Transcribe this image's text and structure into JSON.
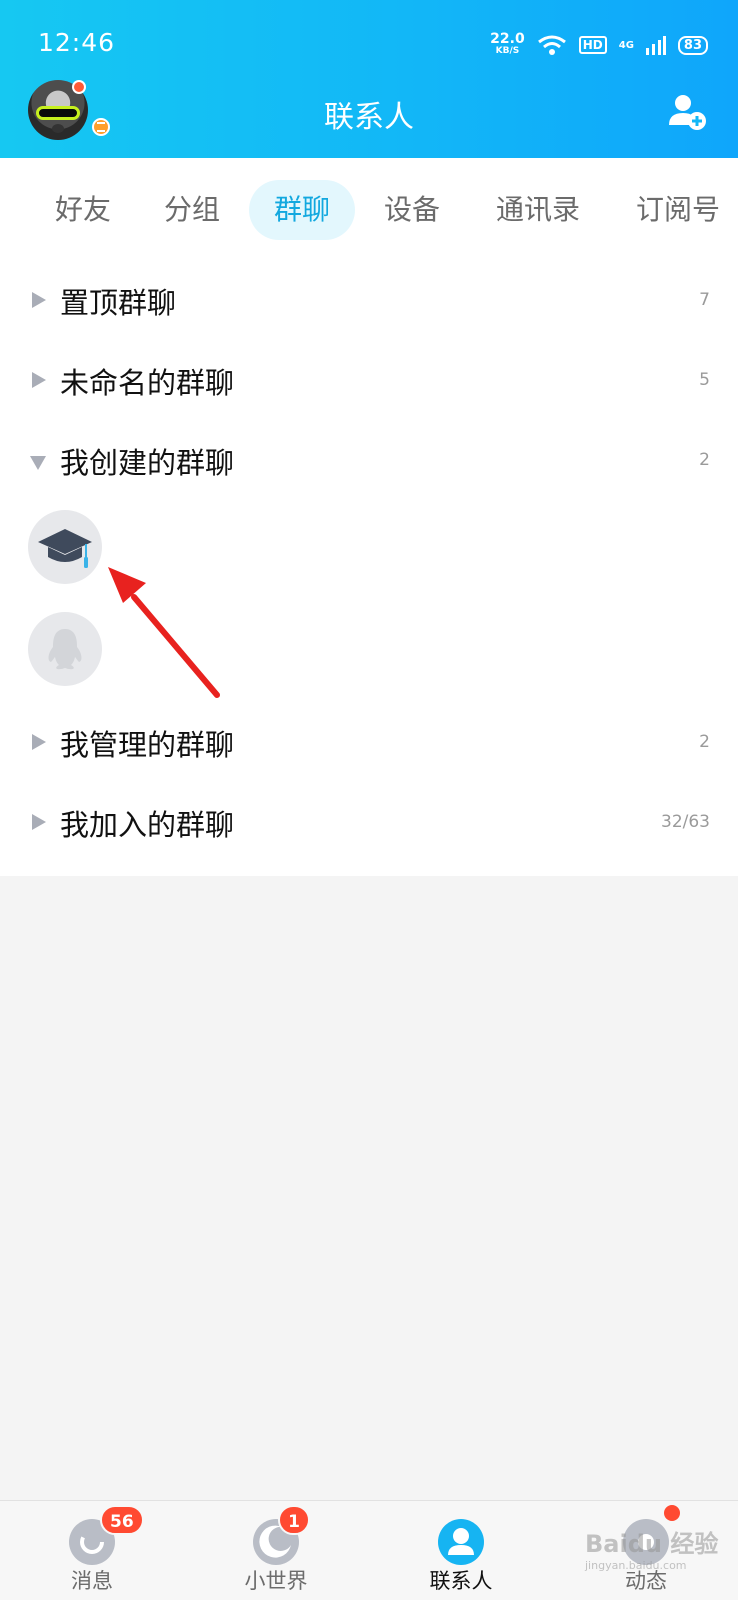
{
  "status_bar": {
    "time": "12:46",
    "net_speed": "22.0",
    "net_unit": "KB/S",
    "hd": "HD",
    "signal_type": "4G",
    "battery": "83"
  },
  "header": {
    "title": "联系人",
    "avatar_icon": "user-avatar",
    "add_icon": "add-contact-icon"
  },
  "tabs": [
    {
      "label": "好友",
      "active": false
    },
    {
      "label": "分组",
      "active": false
    },
    {
      "label": "群聊",
      "active": true
    },
    {
      "label": "设备",
      "active": false
    },
    {
      "label": "通讯录",
      "active": false
    },
    {
      "label": "订阅号",
      "active": false
    }
  ],
  "groups": [
    {
      "label": "置顶群聊",
      "count": "7",
      "expanded": false
    },
    {
      "label": "未命名的群聊",
      "count": "5",
      "expanded": false
    },
    {
      "label": "我创建的群聊",
      "count": "2",
      "expanded": true
    },
    {
      "label": "我管理的群聊",
      "count": "2",
      "expanded": false
    },
    {
      "label": "我加入的群聊",
      "count": "32/63",
      "expanded": false
    }
  ],
  "created_members": [
    {
      "icon": "graduation-cap-icon"
    },
    {
      "icon": "penguin-placeholder-icon"
    }
  ],
  "bottom_nav": [
    {
      "label": "消息",
      "badge": "56",
      "icon": "message-icon",
      "active": false
    },
    {
      "label": "小世界",
      "badge": "1",
      "icon": "small-world-icon",
      "active": false
    },
    {
      "label": "联系人",
      "badge": "",
      "icon": "contacts-icon",
      "active": true
    },
    {
      "label": "动态",
      "badge": "",
      "icon": "feed-icon",
      "active": false
    }
  ],
  "watermark": "Baidu 经验",
  "watermark_sub": "jingyan.baidu.com",
  "colors": {
    "header_start": "#16c8f2",
    "header_end": "#0fa6fb",
    "active_tab_text": "#12a8df",
    "active_tab_bg": "#e3f7fd",
    "badge_red": "#ff4a31",
    "annotation_arrow": "#e8221f"
  }
}
